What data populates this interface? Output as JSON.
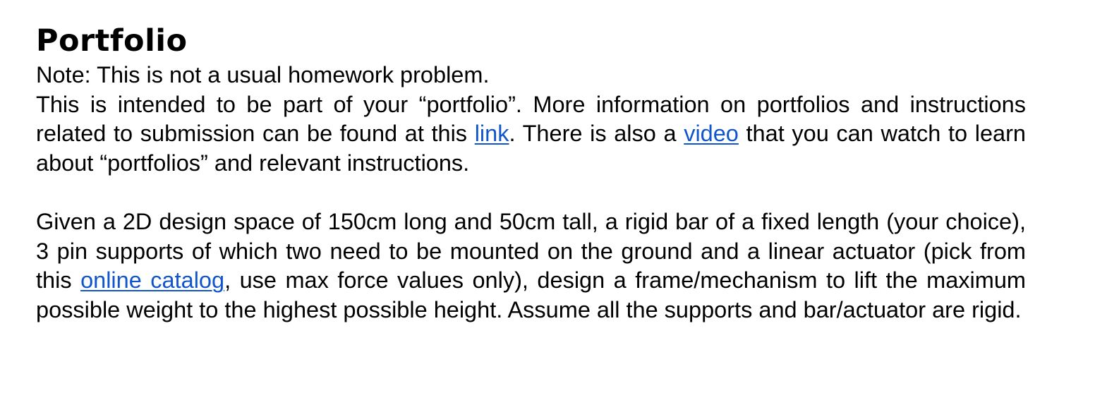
{
  "title": "Portfolio",
  "note": "Note: This is not a usual homework problem.",
  "intro": {
    "text_before_link": "This is intended to be part of your “portfolio”. More information on portfolios and instructions related to submission can be found at this ",
    "link_label": "link",
    "text_between": ". There is also a ",
    "video_label": "video",
    "text_after": " that you can watch to learn about “portfolios” and relevant instructions."
  },
  "problem": {
    "text_before_catalog": "Given a 2D design space of 150cm long and 50cm tall, a rigid bar of a fixed length (your choice), 3 pin supports of which two need to be mounted on the ground and a linear actuator (pick from this ",
    "catalog_label": "online catalog",
    "text_after_catalog": ", use max force values only), design a frame/mechanism to lift the maximum possible weight to the highest possible height. Assume all the supports and bar/actuator are rigid."
  },
  "colors": {
    "link": "#1155cc",
    "text": "#000000"
  }
}
